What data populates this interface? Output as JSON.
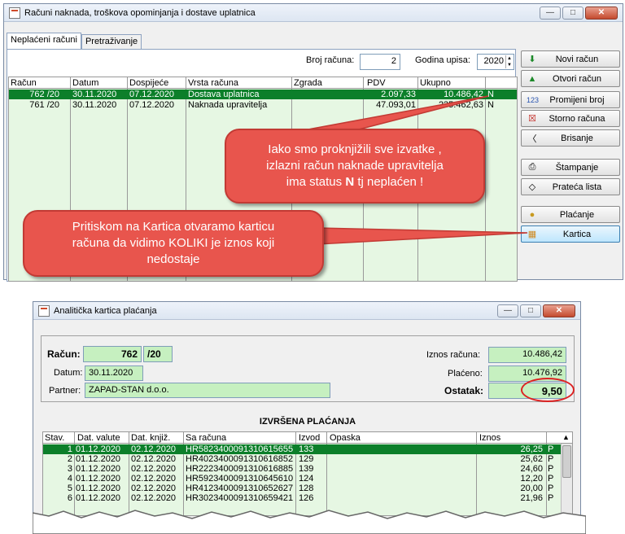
{
  "win1": {
    "title": "Računi naknada, troškova opominjanja i dostave uplatnica",
    "tabs": [
      "Neplaćeni računi",
      "Pretraživanje"
    ],
    "broj_label": "Broj računa:",
    "broj_value": "2",
    "godina_label": "Godina upisa:",
    "godina_value": "2020",
    "columns": [
      "Račun",
      "Datum",
      "Dospijeće",
      "Vrsta računa",
      "Zgrada",
      "PDV",
      "Ukupno"
    ],
    "rows": [
      {
        "racun": "762 /20",
        "datum": "30.11.2020",
        "dospijece": "07.12.2020",
        "vrsta": "Dostava uplatnica",
        "zgrada": "",
        "pdv": "2.097,33",
        "ukupno": "10.486,42",
        "status": "N"
      },
      {
        "racun": "761 /20",
        "datum": "30.11.2020",
        "dospijece": "07.12.2020",
        "vrsta": "Naknada upravitelja",
        "zgrada": "",
        "pdv": "47.093,01",
        "ukupno": "235.462,63",
        "status": "N"
      }
    ],
    "buttons": [
      "Novi račun",
      "Otvori račun",
      "Promijeni broj",
      "Storno računa",
      "Brisanje",
      "Štampanje",
      "Prateća lista",
      "Plaćanje",
      "Kartica"
    ],
    "callout1_a": "Iako smo proknjižili sve izvatke ,",
    "callout1_b": "izlazni račun naknade upravitelja",
    "callout1_c1": "ima status ",
    "callout1_n": "N",
    "callout1_c2": " tj neplaćen !",
    "callout2_a": "Pritiskom na Kartica otvaramo karticu",
    "callout2_b": "računa da vidimo KOLIKI je iznos koji",
    "callout2_c": "nedostaje"
  },
  "win2": {
    "title": "Analitička kartica plaćanja",
    "racun_label": "Račun:",
    "racun_broj": "762",
    "racun_god": "/20",
    "datum_label": "Datum:",
    "datum_value": "30.11.2020",
    "partner_label": "Partner:",
    "partner_value": "ZAPAD-STAN d.o.o.",
    "iznos_label": "Iznos računa:",
    "iznos_value": "10.486,42",
    "placeno_label": "Plaćeno:",
    "placeno_value": "10.476,92",
    "ostatak_label": "Ostatak:",
    "ostatak_value": "9,50",
    "section_title": "IZVRŠENA PLAĆANJA",
    "columns": [
      "Stav.",
      "Dat. valute",
      "Dat. knjiž.",
      "Sa računa",
      "Izvod",
      "Opaska",
      "Iznos"
    ],
    "rows": [
      {
        "stav": "1",
        "valute": "01.12.2020",
        "knjiz": "02.12.2020",
        "racun": "HR5823400091310615655",
        "izvod": "133",
        "iznos": "26,25",
        "p": "P"
      },
      {
        "stav": "2",
        "valute": "01.12.2020",
        "knjiz": "02.12.2020",
        "racun": "HR4023400091310616852",
        "izvod": "129",
        "iznos": "25,62",
        "p": "P"
      },
      {
        "stav": "3",
        "valute": "01.12.2020",
        "knjiz": "02.12.2020",
        "racun": "HR2223400091310616885",
        "izvod": "139",
        "iznos": "24,60",
        "p": "P"
      },
      {
        "stav": "4",
        "valute": "01.12.2020",
        "knjiz": "02.12.2020",
        "racun": "HR5923400091310645610",
        "izvod": "124",
        "iznos": "12,20",
        "p": "P"
      },
      {
        "stav": "5",
        "valute": "01.12.2020",
        "knjiz": "02.12.2020",
        "racun": "HR4123400091310652627",
        "izvod": "128",
        "iznos": "20,00",
        "p": "P"
      },
      {
        "stav": "6",
        "valute": "01.12.2020",
        "knjiz": "02.12.2020",
        "racun": "HR3023400091310659421",
        "izvod": "126",
        "iznos": "21,96",
        "p": "P"
      }
    ]
  }
}
